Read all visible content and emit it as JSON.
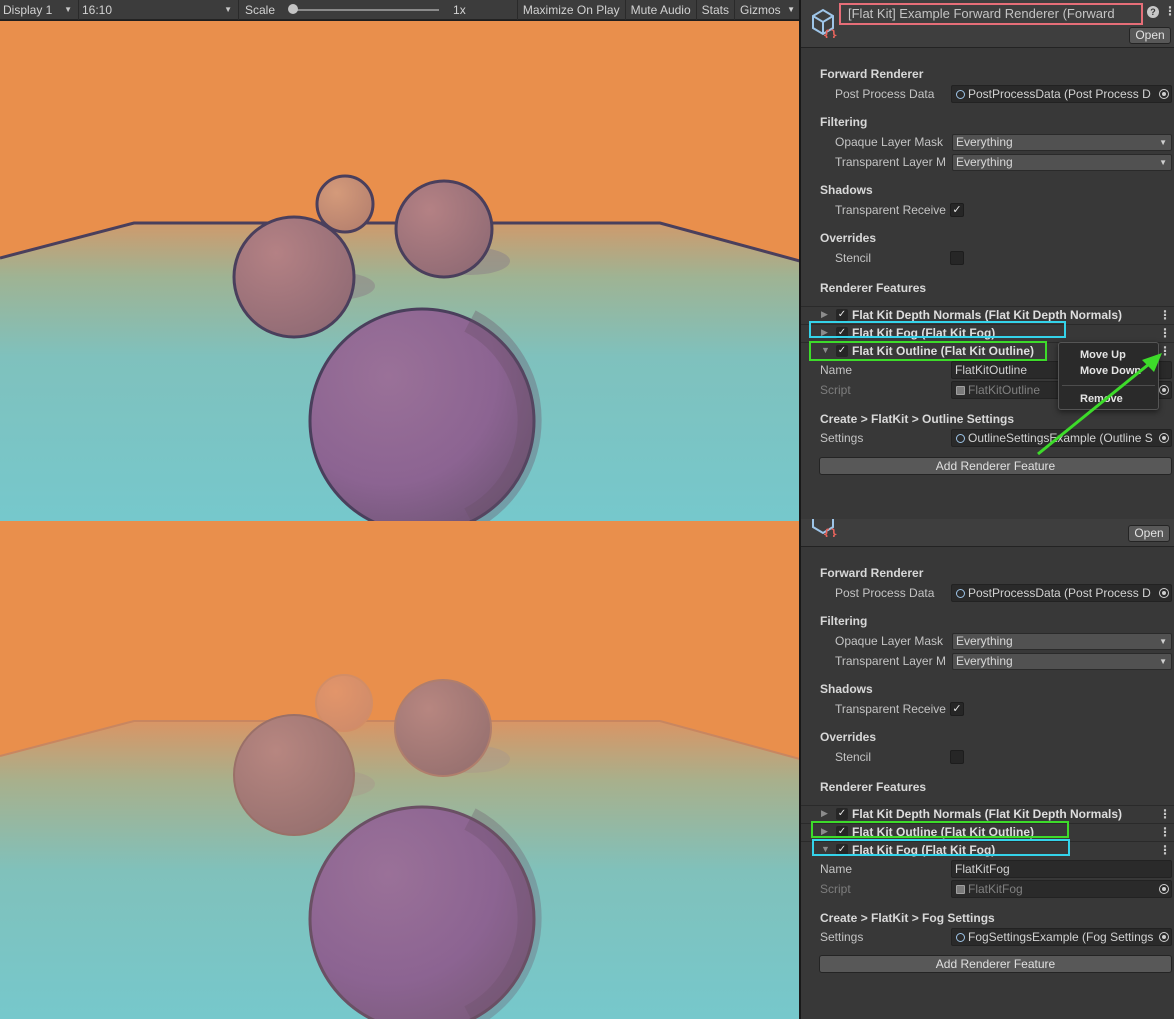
{
  "game_toolbar": {
    "display": "Display 1",
    "aspect": "16:10",
    "scale_label": "Scale",
    "scale_value": "1x",
    "maximize": "Maximize On Play",
    "mute": "Mute Audio",
    "stats": "Stats",
    "gizmos": "Gizmos"
  },
  "colors": {
    "sky": "#e98f4c",
    "ground_near": "#78c7c9",
    "sphere": "#8c6590",
    "outline": "#4a3f5c",
    "highlight_cyan": "#34d3ea",
    "highlight_green": "#3ddb2a",
    "title_highlight": "#e66e78"
  },
  "inspector_top": {
    "title": "[Flat Kit] Example Forward Renderer (Forward",
    "open": "Open",
    "forward_renderer": "Forward Renderer",
    "post_process_label": "Post Process Data",
    "post_process_value": "PostProcessData (Post Process D",
    "filtering": "Filtering",
    "opaque_label": "Opaque Layer Mask",
    "opaque_value": "Everything",
    "transparent_label": "Transparent Layer M",
    "transparent_value": "Everything",
    "shadows": "Shadows",
    "transparent_receive": "Transparent Receive",
    "overrides": "Overrides",
    "stencil": "Stencil",
    "renderer_features": "Renderer Features",
    "features": [
      {
        "name": "Flat Kit Depth Normals (Flat Kit Depth Normals)"
      },
      {
        "name": "Flat Kit Fog (Flat Kit Fog)"
      },
      {
        "name": "Flat Kit Outline (Flat Kit Outline)"
      }
    ],
    "name_label": "Name",
    "name_value": "FlatKitOutline",
    "script_label": "Script",
    "script_value": "FlatKitOutline",
    "settings_header": "Create > FlatKit > Outline Settings",
    "settings_label": "Settings",
    "settings_value": "OutlineSettingsExample (Outline S",
    "add_feature": "Add Renderer Feature"
  },
  "context_menu": {
    "move_up": "Move Up",
    "move_down": "Move Down",
    "remove": "Remove"
  },
  "inspector_bottom": {
    "open": "Open",
    "forward_renderer": "Forward Renderer",
    "post_process_label": "Post Process Data",
    "post_process_value": "PostProcessData (Post Process D",
    "filtering": "Filtering",
    "opaque_label": "Opaque Layer Mask",
    "opaque_value": "Everything",
    "transparent_label": "Transparent Layer M",
    "transparent_value": "Everything",
    "shadows": "Shadows",
    "transparent_receive": "Transparent Receive",
    "overrides": "Overrides",
    "stencil": "Stencil",
    "renderer_features": "Renderer Features",
    "features": [
      {
        "name": "Flat Kit Depth Normals (Flat Kit Depth Normals)"
      },
      {
        "name": "Flat Kit Outline (Flat Kit Outline)"
      },
      {
        "name": "Flat Kit Fog (Flat Kit Fog)"
      }
    ],
    "name_label": "Name",
    "name_value": "FlatKitFog",
    "script_label": "Script",
    "script_value": "FlatKitFog",
    "settings_header": "Create > FlatKit > Fog Settings",
    "settings_label": "Settings",
    "settings_value": "FogSettingsExample (Fog Settings",
    "add_feature": "Add Renderer Feature"
  }
}
